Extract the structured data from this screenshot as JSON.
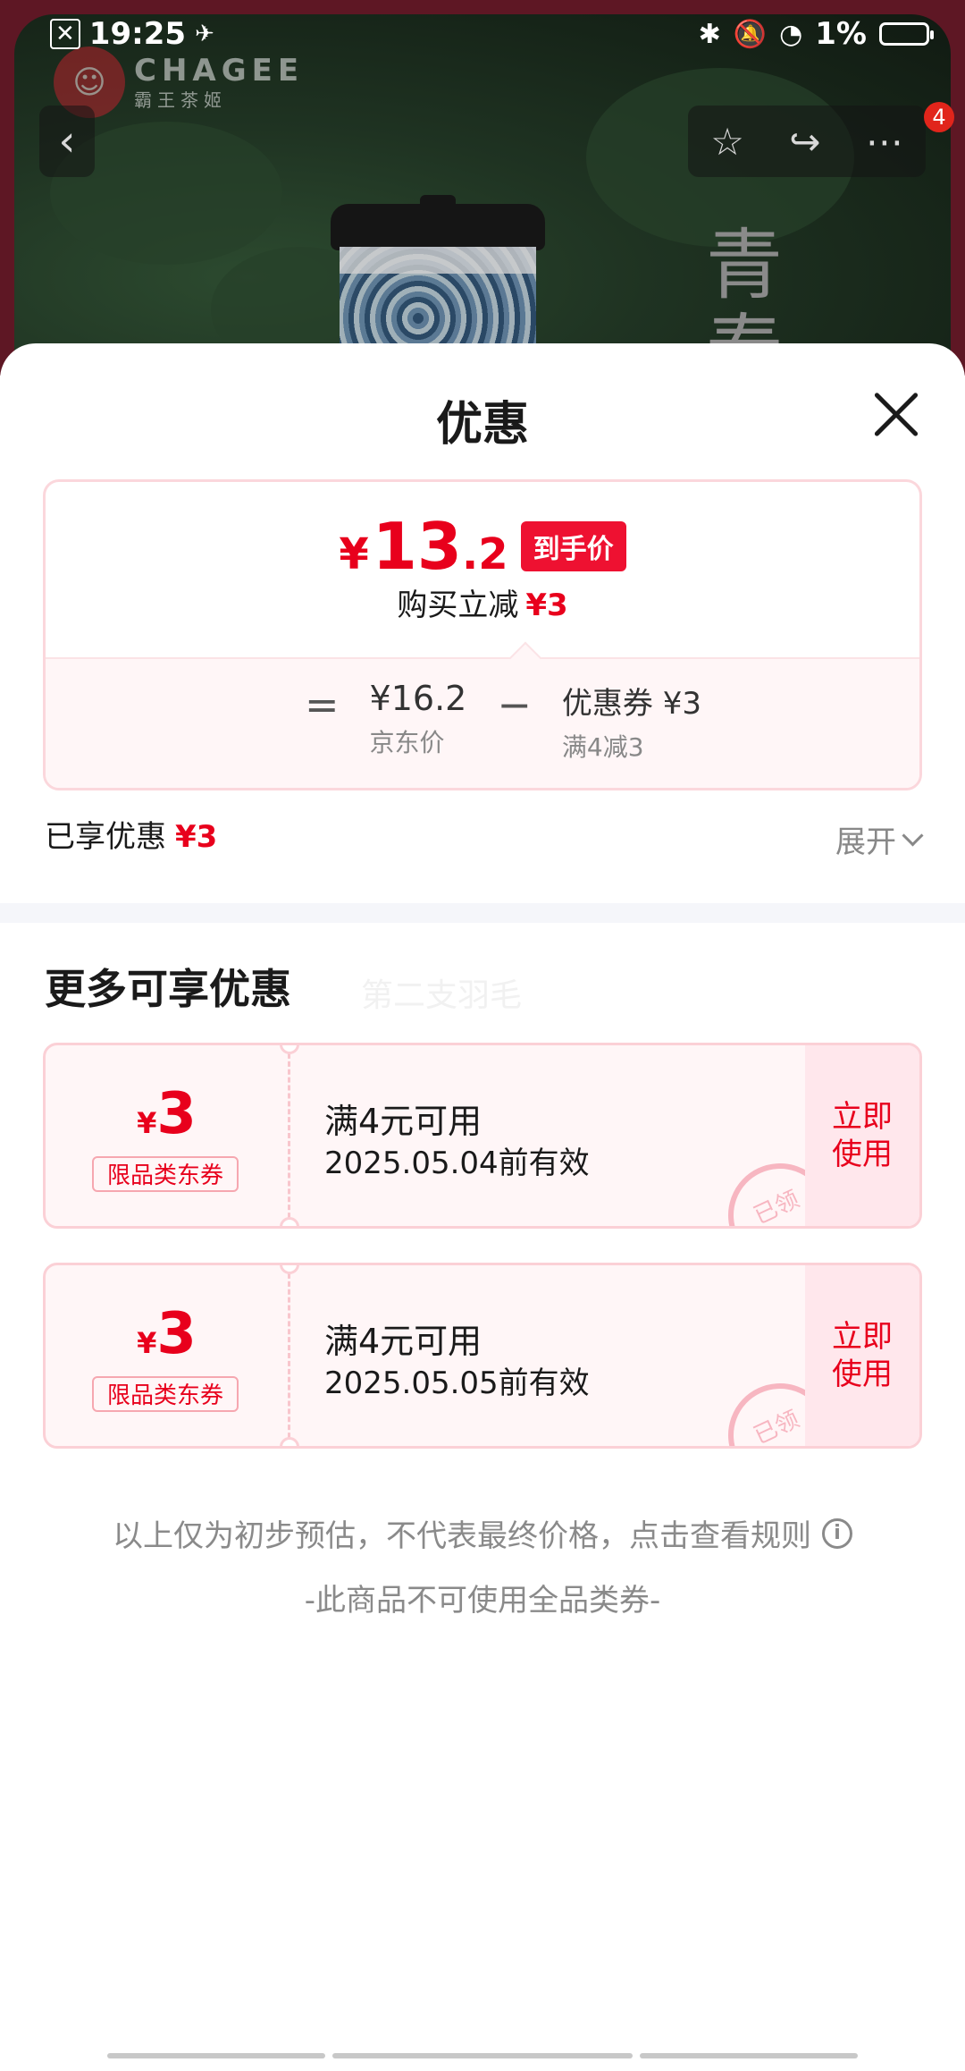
{
  "status_bar": {
    "time": "19:25",
    "battery": "1%"
  },
  "brand": {
    "name": "CHAGEE",
    "sub": "霸王茶姬"
  },
  "nav": {
    "back_icon": "chevron-left-icon",
    "badge": "4"
  },
  "background": {
    "vertical_text": "青\n春"
  },
  "sheet": {
    "title": "优惠"
  },
  "price_card": {
    "currency": "¥",
    "final_int": "13",
    "final_dec": ".2",
    "final_tag": "到手价",
    "instant_label": "购买立减",
    "instant_value": "¥3",
    "eq": "=",
    "jd_price": "¥16.2",
    "jd_label": "京东价",
    "minus": "−",
    "coupon_label": "优惠券 ¥3",
    "coupon_rule": "满4减3"
  },
  "enjoyed": {
    "label": "已享优惠",
    "value": "¥3",
    "expand": "展开"
  },
  "more": {
    "title": "更多可享优惠",
    "ghost_text": "第二支羽毛"
  },
  "coupons": [
    {
      "currency": "¥",
      "amount": "3",
      "type": "限品类东券",
      "condition": "满4元可用",
      "valid": "2025.05.04前有效",
      "use_line1": "立即",
      "use_line2": "使用",
      "stamp": "已领"
    },
    {
      "currency": "¥",
      "amount": "3",
      "type": "限品类东券",
      "condition": "满4元可用",
      "valid": "2025.05.05前有效",
      "use_line1": "立即",
      "use_line2": "使用",
      "stamp": "已领"
    }
  ],
  "notice": "以上仅为初步预估，不代表最终价格，点击查看规则",
  "no_all_coupon": "-此商品不可使用全品类券-",
  "colors": {
    "accent": "#e8001c",
    "tag_bg": "#ee1131",
    "coupon_bg": "#fff6f7"
  }
}
